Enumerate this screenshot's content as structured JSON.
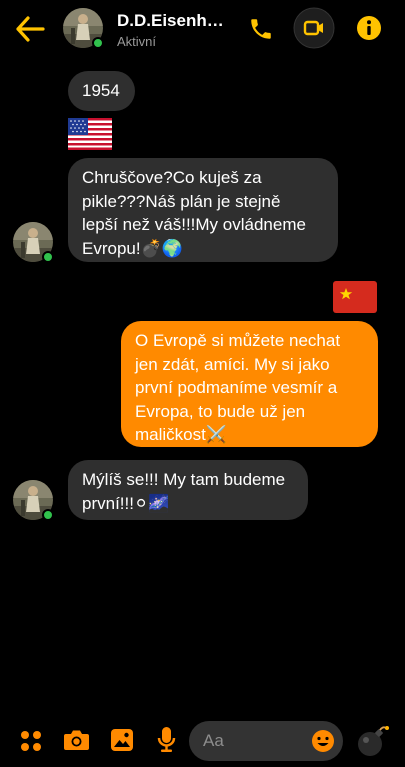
{
  "header": {
    "contact_name": "D.D.Eisenhower",
    "status": "Aktivní"
  },
  "messages": [
    {
      "type": "received",
      "text": "1954"
    },
    {
      "type": "received-emoji",
      "emoji": "us-flag"
    },
    {
      "type": "received",
      "lines": [
        "Chruščove?Co kuješ za",
        "pikle???Náš plán je stejně",
        "lepší než váš!!!My ovládneme",
        "Evropu!💣🌍"
      ]
    },
    {
      "type": "sent-emoji",
      "emoji": "ussr-flag"
    },
    {
      "type": "sent",
      "lines": [
        "O Evropě si můžete nechat",
        "jen zdát, amíci. My si jako",
        "první podmaníme vesmír a",
        "Evropa, to bude už jen",
        "maličkost⚔️"
      ]
    },
    {
      "type": "received",
      "lines": [
        "Mýlíš se!!! My tam budeme",
        "první!!!⚪🌌"
      ]
    }
  ],
  "composer": {
    "placeholder": "Aa"
  },
  "colors": {
    "accent": "#ff8a00",
    "header_icons": "#ffc300",
    "bubble_received": "#2f2f2f",
    "online": "#31c24d"
  },
  "icons": [
    "back-arrow-icon",
    "phone-icon",
    "video-icon",
    "info-icon",
    "apps-icon",
    "camera-icon",
    "gallery-icon",
    "microphone-icon",
    "emoji-icon",
    "bomb-icon"
  ]
}
